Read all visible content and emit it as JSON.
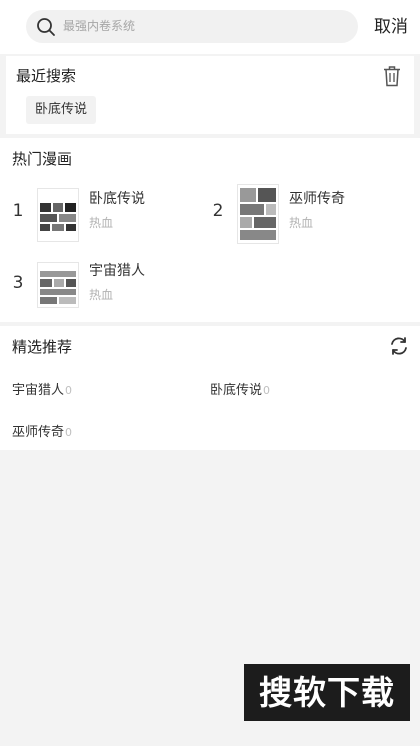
{
  "search": {
    "placeholder": "最强内卷系统",
    "cancel_label": "取消"
  },
  "recent": {
    "title": "最近搜索",
    "items": [
      "卧底传说"
    ]
  },
  "hot": {
    "title": "热门漫画",
    "items": [
      {
        "rank": "1",
        "title": "卧底传说",
        "genre": "热血"
      },
      {
        "rank": "2",
        "title": "巫师传奇",
        "genre": "热血"
      },
      {
        "rank": "3",
        "title": "宇宙猎人",
        "genre": "热血"
      }
    ]
  },
  "picks": {
    "title": "精选推荐",
    "items": [
      {
        "title": "宇宙猎人",
        "count": "0"
      },
      {
        "title": "卧底传说",
        "count": "0"
      },
      {
        "title": "巫师传奇",
        "count": "0"
      }
    ]
  },
  "watermark": "搜软下载"
}
